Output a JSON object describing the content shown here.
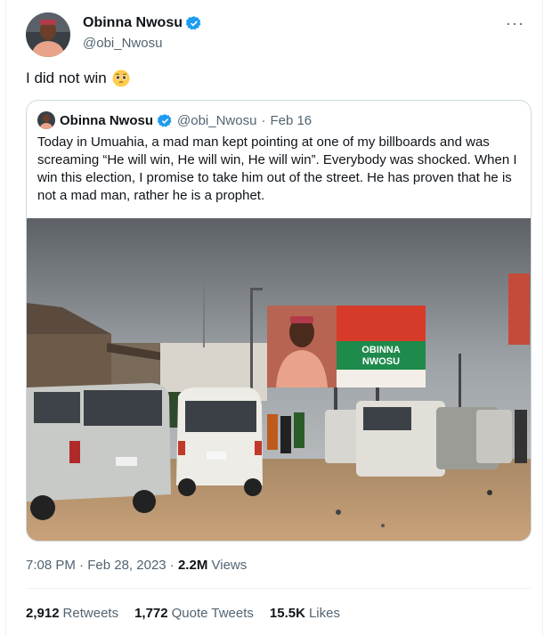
{
  "author": {
    "name": "Obinna Nwosu",
    "handle": "@obi_Nwosu"
  },
  "tweet": {
    "text": "I did not win",
    "emoji": "pleading-face-emoji"
  },
  "quoted": {
    "name": "Obinna Nwosu",
    "handle": "@obi_Nwosu",
    "separator": "·",
    "date": "Feb 16",
    "text": "Today in Umuahia, a mad man kept pointing at one of my billboards and was screaming “He will win, He will win, He will win”. Everybody was shocked. When I win this election, I promise to take him out of the street. He has proven that he is not a mad man, rather he is a prophet.",
    "image": {
      "billboard_line1": "OBINNA",
      "billboard_line2": "NWOSU"
    }
  },
  "meta": {
    "time": "7:08 PM",
    "separator": "·",
    "date": "Feb 28, 2023",
    "views_count": "2.2M",
    "views_label": "Views"
  },
  "stats": {
    "retweets_count": "2,912",
    "retweets_label": "Retweets",
    "quotes_count": "1,772",
    "quotes_label": "Quote Tweets",
    "likes_count": "15.5K",
    "likes_label": "Likes"
  },
  "colors": {
    "verified": "#1d9bf0",
    "secondary_text": "#536471",
    "billboard_green": "#1e8a4c",
    "billboard_red": "#d63b2a"
  }
}
